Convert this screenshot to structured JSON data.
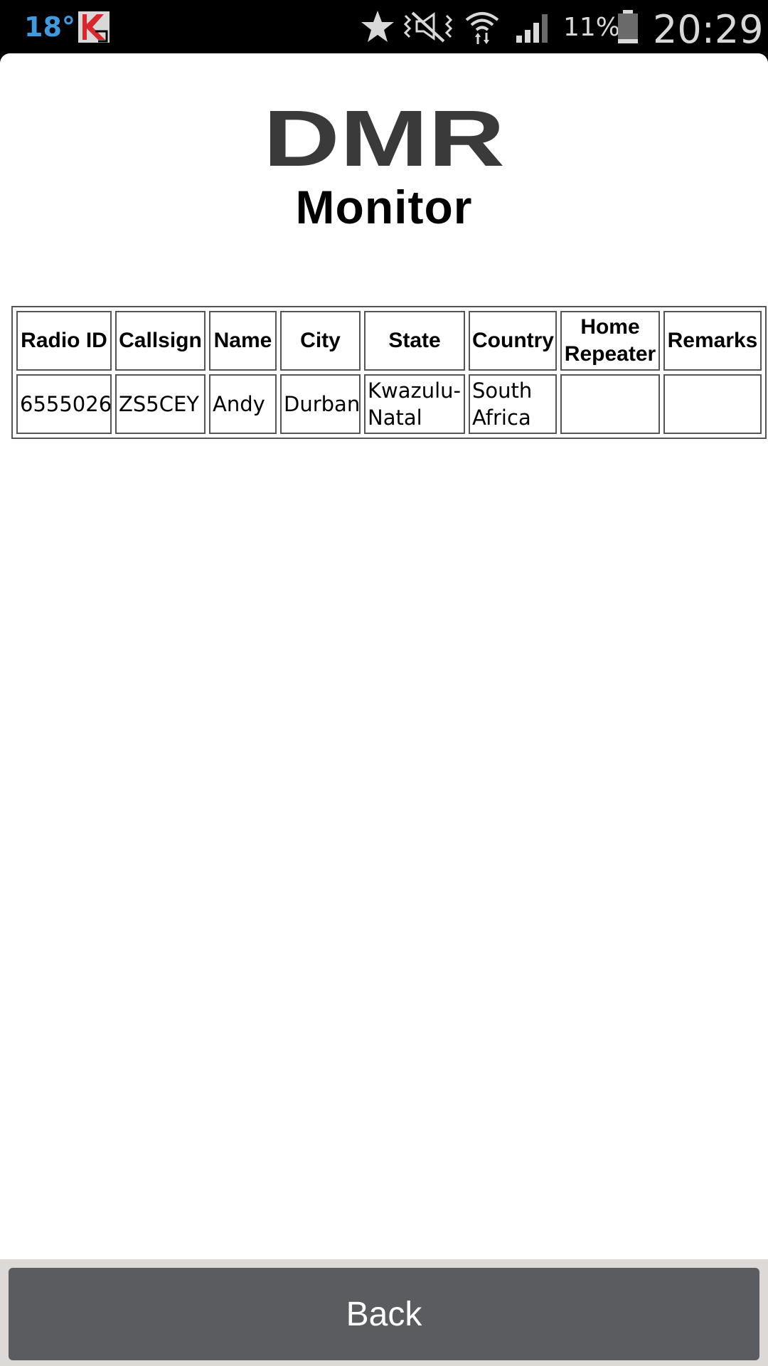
{
  "status_bar": {
    "temperature": "18°",
    "battery_percent": "11%",
    "time": "20:29",
    "icons": [
      "kaspersky-icon",
      "star-icon",
      "vibrate-mute-icon",
      "wifi-icon",
      "signal-icon",
      "battery-icon"
    ]
  },
  "header": {
    "logo_text": "DMR",
    "subtitle": "Monitor"
  },
  "table": {
    "columns": [
      "Radio ID",
      "Callsign",
      "Name",
      "City",
      "State",
      "Country",
      "Home Repeater",
      "Remarks"
    ],
    "rows": [
      [
        "6555026",
        "ZS5CEY",
        "Andy",
        "Durban",
        "Kwazulu-Natal",
        "South Africa",
        "",
        ""
      ]
    ]
  },
  "footer": {
    "back_label": "Back"
  },
  "colors": {
    "temperature": "#3f9be0",
    "button_bg": "#5a5c60",
    "footer_bg": "#ddd9d7",
    "logo": "#3a3a3a"
  }
}
